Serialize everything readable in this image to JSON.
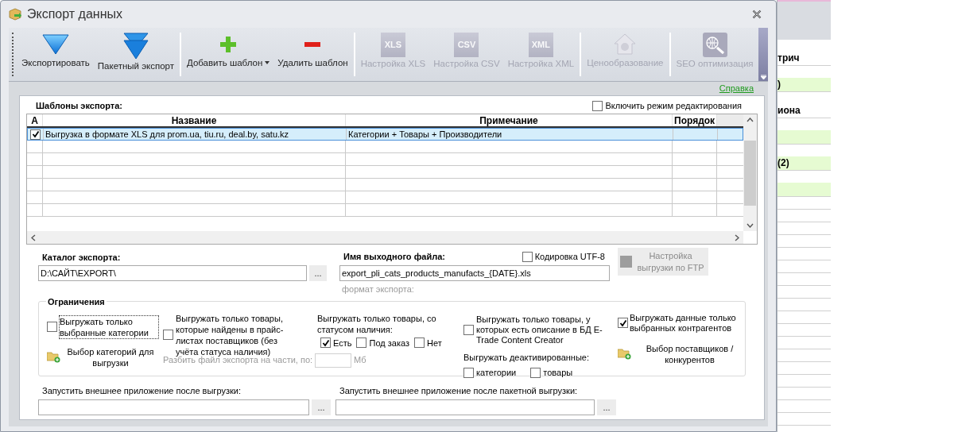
{
  "window": {
    "title": "Экспорт данных"
  },
  "toolbar": {
    "groups": [
      {
        "buttons": [
          {
            "label": "Экспортировать",
            "kind": "export",
            "disabled": false
          },
          {
            "label": "Пакетный экспорт",
            "kind": "batch",
            "disabled": false
          }
        ]
      },
      {
        "buttons": [
          {
            "label": "Добавить шаблон",
            "kind": "add",
            "disabled": false,
            "dropdown": true
          },
          {
            "label": "Удалить шаблон",
            "kind": "remove",
            "disabled": false
          }
        ]
      },
      {
        "buttons": [
          {
            "label": "Настройка XLS",
            "kind": "format",
            "icon_text": "XLS",
            "disabled": true
          },
          {
            "label": "Настройка CSV",
            "kind": "format",
            "icon_text": "CSV",
            "disabled": true
          },
          {
            "label": "Настройка XML",
            "kind": "format",
            "icon_text": "XML",
            "disabled": true
          }
        ]
      },
      {
        "buttons": [
          {
            "label": "Ценообразование",
            "kind": "pricing",
            "disabled": true
          }
        ]
      },
      {
        "buttons": [
          {
            "label": "SEO оптимизация",
            "kind": "seo",
            "disabled": true
          }
        ]
      }
    ]
  },
  "help_link": "Справка",
  "templates": {
    "title": "Шаблоны экспорта:",
    "edit_mode": {
      "label": "Включить режим редактирования",
      "checked": false
    },
    "columns": [
      "A",
      "Название",
      "Примечание",
      "Порядок"
    ],
    "rows": [
      {
        "active": true,
        "name": "Выгрузка в формате XLS для prom.ua, tiu.ru, deal.by, satu.kz",
        "note": "Категории + Товары + Производители",
        "selected": true
      }
    ]
  },
  "catalog": {
    "label": "Каталог экспорта:",
    "value": "D:\\САЙТ\\EXPORT\\",
    "browse": "..."
  },
  "output_file": {
    "label": "Имя выходного файла:",
    "value": "export_pli_cats_products_manufacts_{DATE}.xls",
    "utf8": {
      "label": "Кодировка UTF-8",
      "checked": false
    },
    "format_hint": "формат экспорта:"
  },
  "ftp_button": {
    "label": "Настройка выгрузки по FTP",
    "disabled": true
  },
  "restrictions": {
    "title": "Ограничения",
    "only_selected_categories": {
      "label": "Выгружать только выбранные категории",
      "checked": false,
      "focused": true
    },
    "choose_categories": "Выбор категорий для выгрузки",
    "only_in_pricelists": {
      "label": "Выгружать только товары, которые найдены в прайс-листах поставщиков (без учёта статуса наличия)",
      "checked": false
    },
    "split": {
      "label": "Разбить файл экспорта на части, по:",
      "unit": "Мб",
      "disabled": true
    },
    "stock_status": {
      "label": "Выгружать только товары, со статусом наличия:",
      "options": [
        {
          "label": "Есть",
          "checked": true
        },
        {
          "label": "Под заказ",
          "checked": false
        },
        {
          "label": "Нет",
          "checked": false
        }
      ]
    },
    "only_described": {
      "label": "Выгружать только товары, у которых есть описание в БД E-Trade Content Creator",
      "checked": false
    },
    "deactivated": {
      "label": "Выгружать деактивированные:",
      "options": [
        {
          "label": "категории",
          "checked": false
        },
        {
          "label": "товары",
          "checked": false
        }
      ]
    },
    "only_selected_contractors": {
      "label": "Выгружать данные только выбранных контрагентов",
      "checked": true
    },
    "choose_suppliers": "Выбор поставщиков / конкурентов"
  },
  "after_export": {
    "label": "Запустить внешнее приложение после выгрузки:",
    "browse": "..."
  },
  "after_batch_export": {
    "label": "Запустить внешнее приложение после пакетной выгрузки:",
    "browse": "..."
  },
  "background_app": {
    "rows": [
      {
        "text": "трич",
        "highlighted": false
      },
      {
        "text": ")",
        "highlighted": true
      },
      {
        "text": "иона",
        "highlighted": false
      },
      {
        "highlighted": true
      },
      {
        "text": "(2)",
        "highlighted": true
      },
      {
        "highlighted": true
      }
    ]
  }
}
